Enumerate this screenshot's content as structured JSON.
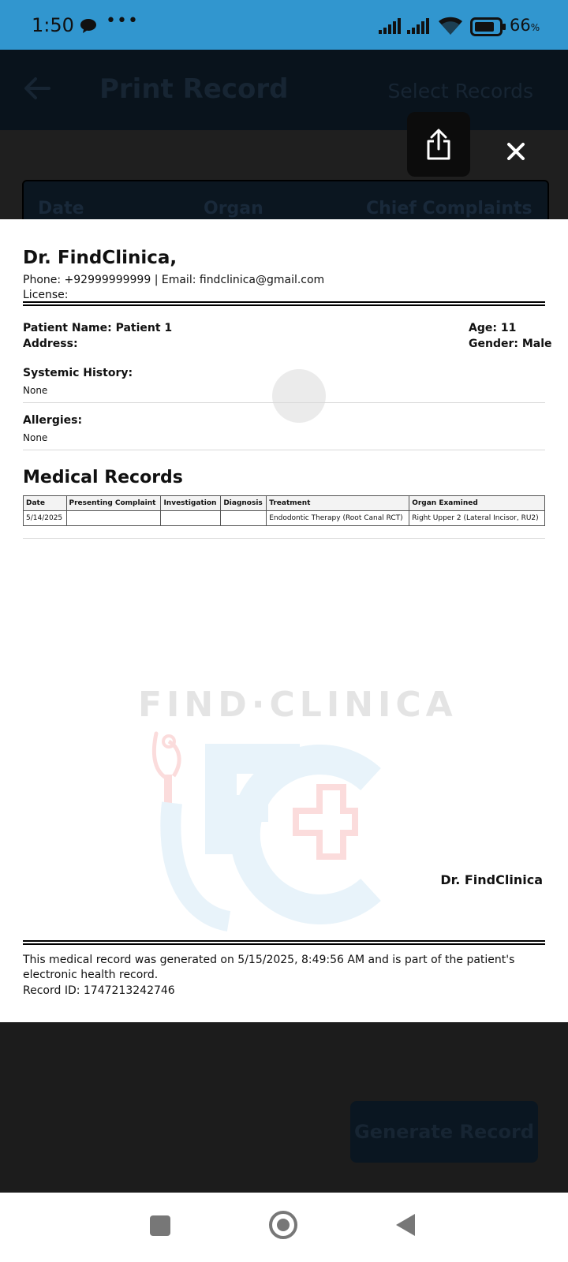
{
  "status_bar": {
    "time": "1:50",
    "more": "•••",
    "battery_level": "66",
    "battery_unit": "%"
  },
  "app_header": {
    "title": "Print Record",
    "select_records": "Select Records"
  },
  "app_table": {
    "columns": [
      "Date",
      "Organ",
      "Chief Complaints"
    ]
  },
  "viewer": {
    "share_icon": "share-icon",
    "close_icon": "close-icon"
  },
  "document": {
    "doctor_name": "Dr. FindClinica,",
    "contact": "Phone: +92999999999 | Email: findclinica@gmail.com",
    "license": "License:",
    "patient": {
      "name": "Patient Name: Patient 1",
      "address": "Address:",
      "age": "Age: 11",
      "gender": "Gender: Male"
    },
    "systemic_history": {
      "label": "Systemic History:",
      "value": "None"
    },
    "allergies": {
      "label": "Allergies:",
      "value": "None"
    },
    "records_title": "Medical Records",
    "table": {
      "headers": [
        "Date",
        "Presenting Complaint",
        "Investigation",
        "Diagnosis",
        "Treatment",
        "Organ Examined"
      ],
      "rows": [
        [
          "5/14/2025",
          "",
          "",
          "",
          "Endodontic Therapy (Root Canal RCT)",
          "Right Upper 2 (Lateral Incisor, RU2)"
        ]
      ]
    },
    "watermark_text": "FIND·CLINICA",
    "signature": "Dr. FindClinica",
    "footer": "This medical record was generated on 5/15/2025, 8:49:56 AM and is part of the patient's electronic health record.",
    "record_id": "Record ID: 1747213242746"
  },
  "bottom": {
    "generate_button": "Generate Record"
  },
  "colors": {
    "status_bar": "#3196cf",
    "watermark_blue": "#e8f3fa",
    "watermark_red": "#fbdcdc"
  }
}
